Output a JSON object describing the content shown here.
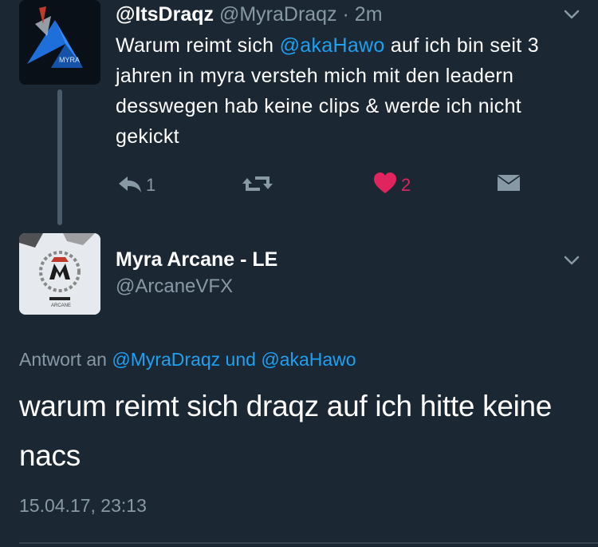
{
  "tweet1": {
    "display_name": "@ItsDraqz",
    "handle_time": "@MyraDraqz · 2m",
    "text_before": "Warum reimt sich ",
    "mention": "@akaHawo",
    "text_after": " auf ich bin seit 3 jahren in myra versteh mich mit den leadern desswegen hab keine clips & werde ich nicht gekickt",
    "reply_count": "1",
    "like_count": "2",
    "avatar_text": "MYRA"
  },
  "tweet2": {
    "display_name": "Myra Arcane - LE",
    "handle": "@ArcaneVFX",
    "reply_prefix": "Antwort an ",
    "reply_user1": "@MyraDraqz",
    "reply_conj": " und ",
    "reply_user2": "@akaHawo",
    "text": "warum reimt sich draqz auf ich hitte keine nacs",
    "timestamp": "15.04.17, 23:13",
    "avatar_text": "ARCANE"
  },
  "colors": {
    "background": "#1b2733",
    "accent": "#1da1f2",
    "like": "#e0245e",
    "muted": "#8899a6"
  }
}
